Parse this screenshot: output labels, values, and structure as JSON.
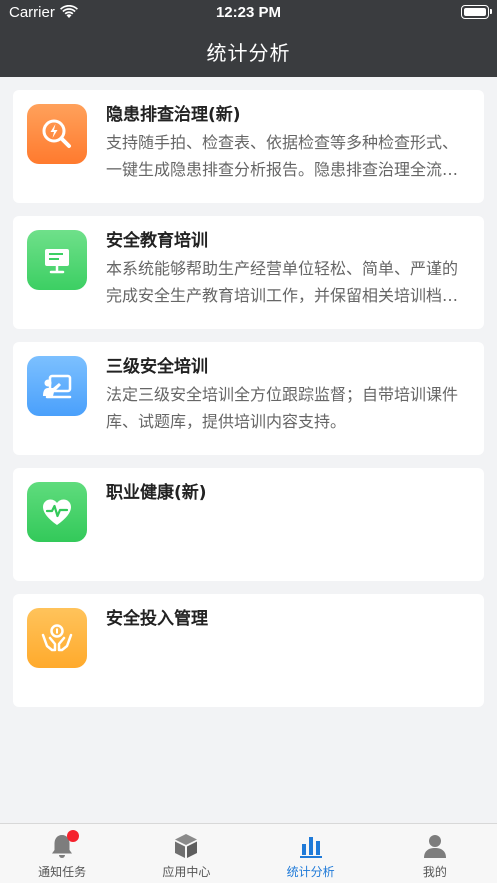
{
  "status_bar": {
    "carrier": "Carrier",
    "time": "12:23 PM"
  },
  "header": {
    "title": "统计分析"
  },
  "modules": [
    {
      "title": "隐患排查治理(新)",
      "description": "支持随手拍、检查表、依据检查等多种检查形式、一键生成隐患排查分析报告。隐患排查治理全流程管理。",
      "icon": "search-lightning-icon",
      "color": "#ff8a3d"
    },
    {
      "title": "安全教育培训",
      "description": "本系统能够帮助生产经营单位轻松、简单、严谨的完成安全生产教育培训工作，并保留相关培训档案。",
      "icon": "presentation-board-icon",
      "color": "#4dd672"
    },
    {
      "title": "三级安全培训",
      "description": "法定三级安全培训全方位跟踪监督；自带培训课件库、试题库，提供培训内容支持。",
      "icon": "teaching-screen-icon",
      "color": "#5aabfd"
    },
    {
      "title": "职业健康(新)",
      "description": "",
      "icon": "heart-pulse-icon",
      "color": "#44d068"
    },
    {
      "title": "安全投入管理",
      "description": "",
      "icon": "hands-coin-icon",
      "color": "#ffb13f"
    }
  ],
  "tabbar": {
    "tabs": [
      {
        "label": "通知任务",
        "icon": "bell-icon",
        "badge": true,
        "active": false
      },
      {
        "label": "应用中心",
        "icon": "cube-icon",
        "active": false
      },
      {
        "label": "统计分析",
        "icon": "bar-chart-icon",
        "active": true
      },
      {
        "label": "我的",
        "icon": "person-icon",
        "active": false
      }
    ],
    "active_color": "#1f7ad8"
  }
}
